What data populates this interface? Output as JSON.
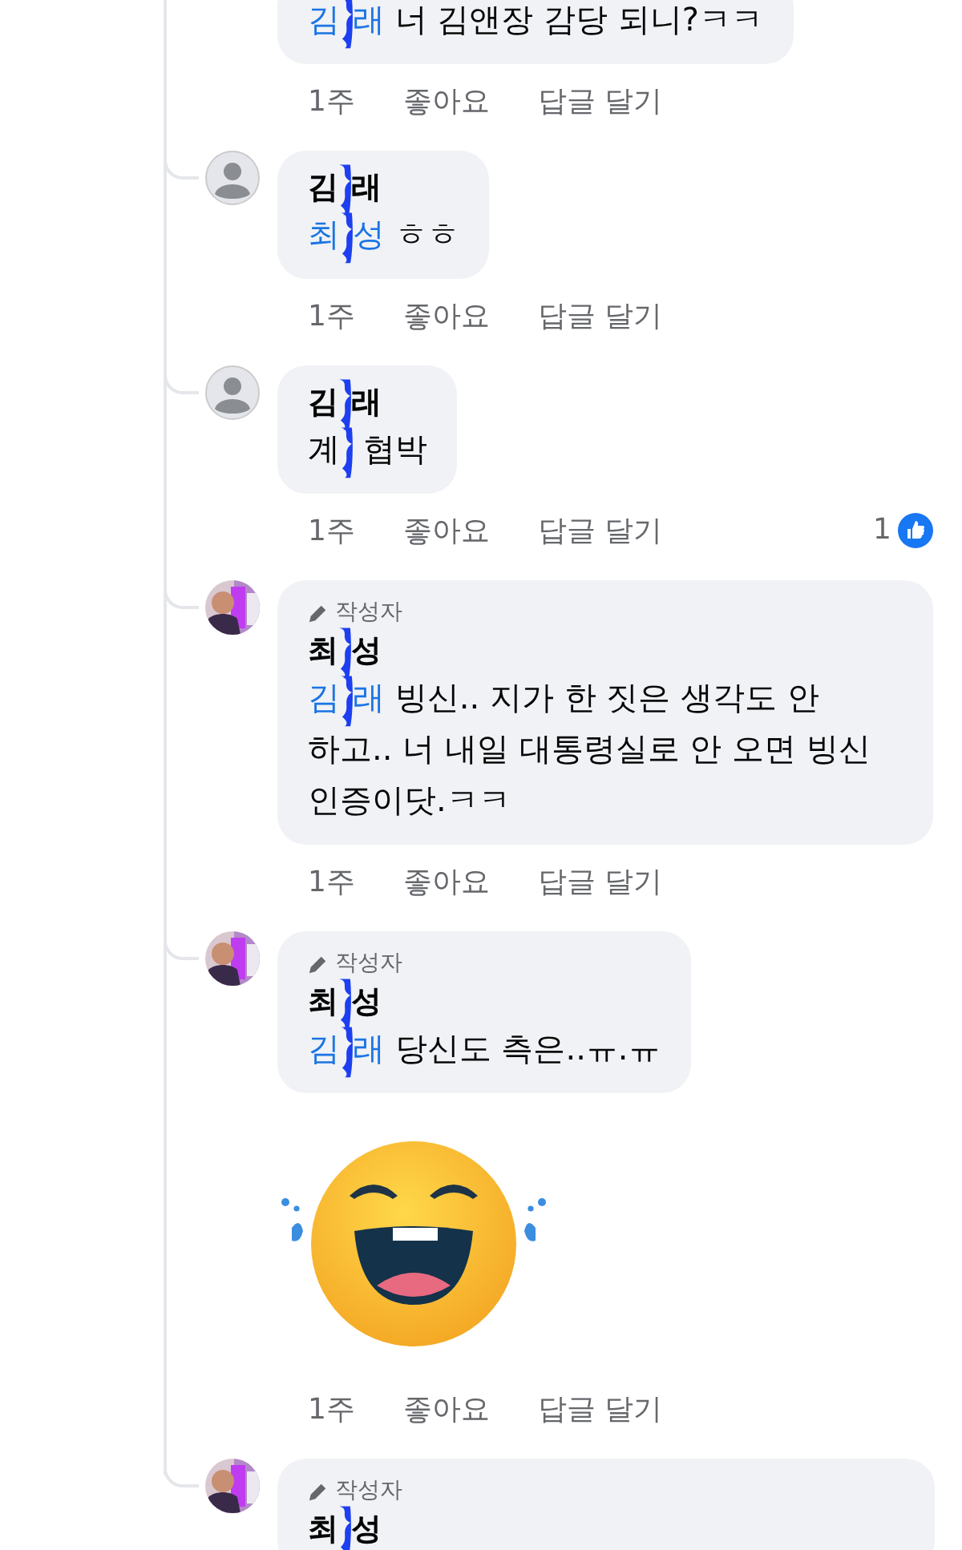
{
  "comments": [
    {
      "body": [
        {
          "kind": "mention",
          "text": "김"
        },
        {
          "kind": "redacted"
        },
        {
          "kind": "mention",
          "text": "래"
        },
        {
          "kind": "text",
          "text": " 너 김앤장 감당 되니?ㅋㅋ"
        }
      ],
      "actions": {
        "time": "1주",
        "like": "좋아요",
        "reply": "답글 달기"
      }
    },
    {
      "avatar": {
        "kind": "default"
      },
      "name": [
        {
          "kind": "text",
          "text": "김"
        },
        {
          "kind": "redacted"
        },
        {
          "kind": "text",
          "text": "래"
        }
      ],
      "body": [
        {
          "kind": "mention",
          "text": "최"
        },
        {
          "kind": "redacted"
        },
        {
          "kind": "mention",
          "text": "성"
        },
        {
          "kind": "text",
          "text": " ㅎㅎ"
        }
      ],
      "actions": {
        "time": "1주",
        "like": "좋아요",
        "reply": "답글 달기"
      }
    },
    {
      "avatar": {
        "kind": "default"
      },
      "name": [
        {
          "kind": "text",
          "text": "김"
        },
        {
          "kind": "redacted"
        },
        {
          "kind": "text",
          "text": "래"
        }
      ],
      "body": [
        {
          "kind": "text",
          "text": "계"
        },
        {
          "kind": "redacted"
        },
        {
          "kind": "text",
          "text": " 협박"
        }
      ],
      "actions": {
        "time": "1주",
        "like": "좋아요",
        "reply": "답글 달기"
      },
      "reaction_count": "1"
    },
    {
      "avatar": {
        "kind": "picture"
      },
      "author_badge": "작성자",
      "name": [
        {
          "kind": "text",
          "text": "최"
        },
        {
          "kind": "redacted"
        },
        {
          "kind": "text",
          "text": "성"
        }
      ],
      "body": [
        {
          "kind": "mention",
          "text": "김"
        },
        {
          "kind": "redacted"
        },
        {
          "kind": "mention",
          "text": "래"
        },
        {
          "kind": "text",
          "text": " 빙신.. 지가 한 짓은 생각도 안 하고..  너 내일 대통령실로 안 오면 빙신 인증이닷.ㅋㅋ"
        }
      ],
      "actions": {
        "time": "1주",
        "like": "좋아요",
        "reply": "답글 달기"
      }
    },
    {
      "avatar": {
        "kind": "picture"
      },
      "author_badge": "작성자",
      "name": [
        {
          "kind": "text",
          "text": "최"
        },
        {
          "kind": "redacted"
        },
        {
          "kind": "text",
          "text": "성"
        }
      ],
      "body": [
        {
          "kind": "mention",
          "text": "김"
        },
        {
          "kind": "redacted"
        },
        {
          "kind": "mention",
          "text": "래"
        },
        {
          "kind": "text",
          "text": " 당신도 측은..ㅠ.ㅠ"
        }
      ],
      "sticker": {
        "kind": "laughing-face"
      },
      "actions": {
        "time": "1주",
        "like": "좋아요",
        "reply": "답글 달기"
      }
    },
    {
      "avatar": {
        "kind": "picture"
      },
      "author_badge": "작성자",
      "name": [
        {
          "kind": "text",
          "text": "최"
        },
        {
          "kind": "redacted"
        },
        {
          "kind": "text",
          "text": "성"
        }
      ]
    }
  ]
}
